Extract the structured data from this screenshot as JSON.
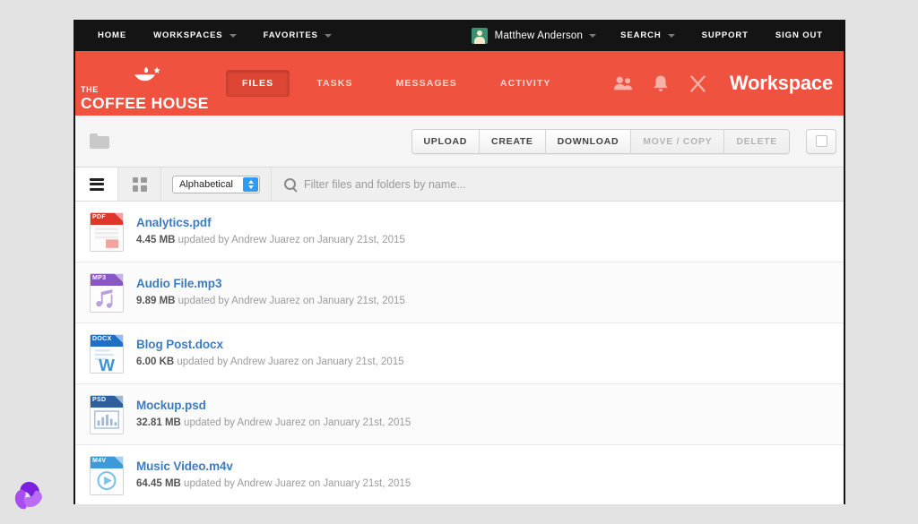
{
  "topnav": {
    "left_items": [
      {
        "label": "HOME",
        "caret": false
      },
      {
        "label": "WORKSPACES",
        "caret": true
      },
      {
        "label": "FAVORITES",
        "caret": true
      }
    ],
    "user": {
      "name": "Matthew Anderson",
      "avatar": "user-avatar"
    },
    "right_items": [
      {
        "label": "SEARCH",
        "caret": true
      },
      {
        "label": "SUPPORT",
        "caret": false
      },
      {
        "label": "SIGN OUT",
        "caret": false
      }
    ]
  },
  "brand": {
    "logo_the": "THE",
    "logo_name": "COFFEE HOUSE",
    "logo_mark": "coffee-cup-star-icon",
    "accent_color": "#ef5340",
    "tabs": [
      {
        "label": "FILES",
        "active": true
      },
      {
        "label": "TASKS",
        "active": false
      },
      {
        "label": "MESSAGES",
        "active": false
      },
      {
        "label": "ACTIVITY",
        "active": false
      }
    ],
    "icons": [
      {
        "name": "people-icon"
      },
      {
        "name": "bell-icon"
      },
      {
        "name": "tools-icon"
      }
    ],
    "title": "Workspace"
  },
  "actionbar": {
    "breadcrumb_icon": "folder-icon",
    "buttons": [
      {
        "label": "UPLOAD",
        "disabled": false
      },
      {
        "label": "CREATE",
        "disabled": false
      },
      {
        "label": "DOWNLOAD",
        "disabled": false
      },
      {
        "label": "MOVE / COPY",
        "disabled": true
      },
      {
        "label": "DELETE",
        "disabled": true
      }
    ],
    "select_all_icon": "checkbox-icon"
  },
  "filterbar": {
    "list_view_icon": "list-view-icon",
    "grid_view_icon": "grid-view-icon",
    "sort": {
      "value": "Alphabetical"
    },
    "search": {
      "icon": "search-icon",
      "value": "",
      "placeholder": "Filter files and folders by name..."
    }
  },
  "files": [
    {
      "name": "Analytics.pdf",
      "ext": "PDF",
      "size": "4.45 MB",
      "meta": " updated by Andrew Juarez on January 21st, 2015",
      "icon_color": "#e0352a",
      "glyph": "pdf-icon"
    },
    {
      "name": "Audio File.mp3",
      "ext": "MP3",
      "size": "9.89 MB",
      "meta": " updated by Andrew Juarez on January 21st, 2015",
      "icon_color": "#8a55c4",
      "glyph": "music-notes-icon"
    },
    {
      "name": "Blog Post.docx",
      "ext": "DOCX",
      "size": "6.00 KB",
      "meta": " updated by Andrew Juarez on January 21st, 2015",
      "icon_color": "#1f6fc4",
      "glyph": "word-icon"
    },
    {
      "name": "Mockup.psd",
      "ext": "PSD",
      "size": "32.81 MB",
      "meta": " updated by Andrew Juarez on January 21st, 2015",
      "icon_color": "#2c5f9e",
      "glyph": "image-icon"
    },
    {
      "name": "Music Video.m4v",
      "ext": "M4V",
      "size": "64.45 MB",
      "meta": " updated by Andrew Juarez on January 21st, 2015",
      "icon_color": "#3c9ad9",
      "glyph": "play-icon"
    }
  ],
  "watermark": {
    "name": "pinwheel-logo",
    "color": "#9b3cf0"
  }
}
